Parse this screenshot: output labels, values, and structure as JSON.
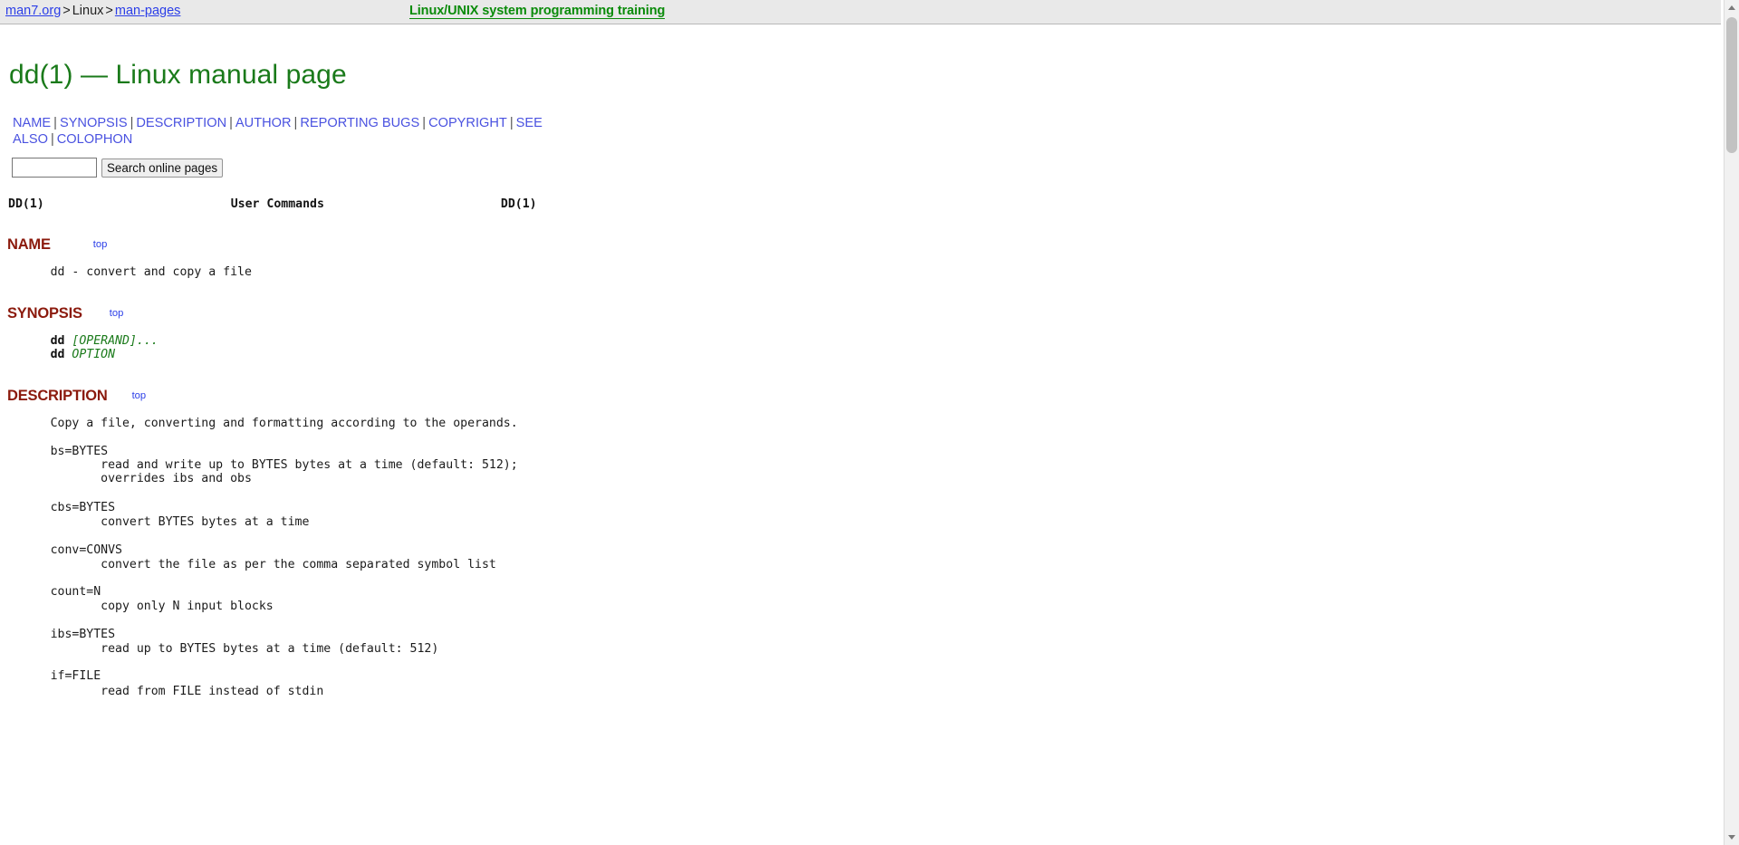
{
  "breadcrumb": {
    "root_label": "man7.org",
    "sep1": ">",
    "mid_label": "Linux",
    "sep2": ">",
    "leaf_label": "man-pages",
    "tagline": "Linux/UNIX system programming training"
  },
  "page": {
    "title": "dd(1) — Linux manual page"
  },
  "section_nav": {
    "links": [
      "NAME",
      "SYNOPSIS",
      "DESCRIPTION",
      "AUTHOR",
      "REPORTING BUGS",
      "COPYRIGHT",
      "SEE ALSO",
      "COLOPHON"
    ],
    "separator": "|"
  },
  "search": {
    "value": "",
    "placeholder": "",
    "button_label": "Search online pages"
  },
  "man": {
    "header_left": "DD(1)",
    "header_center": "User Commands",
    "header_right": "DD(1)",
    "top_label": "top",
    "sections": [
      {
        "id": "name",
        "heading": "NAME",
        "body": "       dd - convert and copy a file"
      },
      {
        "id": "synopsis",
        "heading": "SYNOPSIS",
        "body_line1_cmd": "dd",
        "body_line1_operand": "[OPERAND]...",
        "body_line2_cmd": "dd",
        "body_line2_operand": "OPTION"
      },
      {
        "id": "description",
        "heading": "DESCRIPTION",
        "intro": "       Copy a file, converting and formatting according to the operands.",
        "operands": [
          {
            "term": "       bs=BYTES",
            "desc": "              read and write up to BYTES bytes at a time (default: 512);\n              overrides ibs and obs"
          },
          {
            "term": "       cbs=BYTES",
            "desc": "              convert BYTES bytes at a time"
          },
          {
            "term": "       conv=CONVS",
            "desc": "              convert the file as per the comma separated symbol list"
          },
          {
            "term": "       count=N",
            "desc": "              copy only N input blocks"
          },
          {
            "term": "       ibs=BYTES",
            "desc": "              read up to BYTES bytes at a time (default: 512)"
          },
          {
            "term": "       if=FILE",
            "desc": "              read from FILE instead of stdin"
          }
        ]
      }
    ]
  },
  "colors": {
    "link": "#2b3ee8",
    "heading_green": "#1a7a1a",
    "section_maroon": "#8b1a0d",
    "tagline_green": "#0a8b0a",
    "operand_green": "#1a7a1a"
  },
  "scrollbar": {
    "up_icon": "chevron-up-icon",
    "down_icon": "chevron-down-icon"
  }
}
